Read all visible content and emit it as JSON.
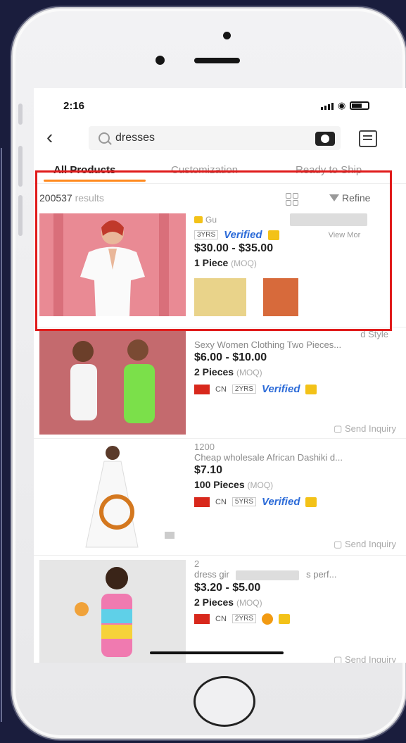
{
  "status_bar": {
    "time": "2:16"
  },
  "search": {
    "query": "dresses"
  },
  "tabs": [
    {
      "label": "All Products"
    },
    {
      "label": "Customization"
    },
    {
      "label": "Ready to Ship"
    }
  ],
  "results": {
    "count": "200537",
    "suffix": "results",
    "refine_label": "Refine"
  },
  "items": [
    {
      "supplier": "Gu",
      "years": "3YRS",
      "verified": "Verified",
      "view_more": "View Mor",
      "price": "$30.00 - $35.00",
      "moq_qty": "1 Piece",
      "moq_label": "(MOQ)"
    },
    {
      "title_tail": "d Style",
      "subtitle": "Sexy Women Clothing Two Pieces...",
      "price": "$6.00 - $10.00",
      "moq_qty": "2 Pieces",
      "moq_label": "(MOQ)",
      "country": "CN",
      "years": "2YRS",
      "verified": "Verified",
      "inquiry": "Send Inquiry"
    },
    {
      "title_head": "1200",
      "subtitle": "Cheap wholesale African Dashiki d...",
      "price": "$7.10",
      "moq_qty": "100 Pieces",
      "moq_label": "(MOQ)",
      "country": "CN",
      "years": "5YRS",
      "verified": "Verified",
      "inquiry": "Send Inquiry"
    },
    {
      "title_head": "2",
      "subtitle_head": "dress gir",
      "subtitle_tail": "s perf...",
      "price": "$3.20 - $5.00",
      "moq_qty": "2 Pieces",
      "moq_label": "(MOQ)",
      "country": "CN",
      "years": "2YRS",
      "inquiry": "Send Inquiry"
    }
  ],
  "colors": {
    "accent": "#ff8a1f",
    "highlight": "#e01b1b",
    "verified": "#2c6bd8"
  }
}
